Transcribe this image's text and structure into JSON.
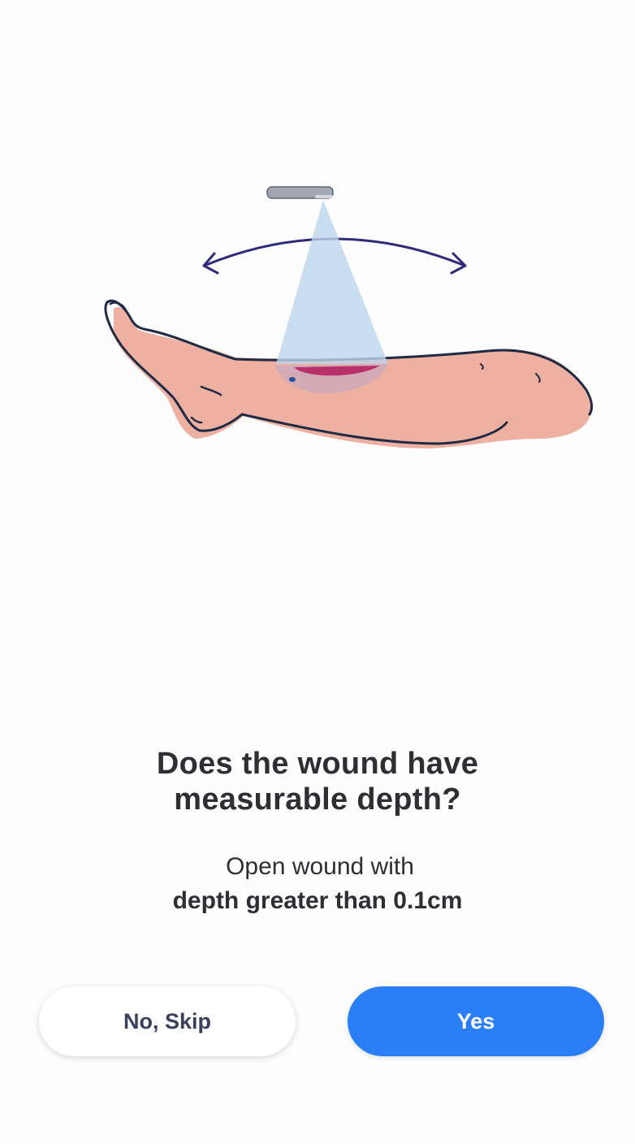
{
  "question": {
    "title_line1": "Does the wound have",
    "title_line2": "measurable depth?",
    "desc_line1": "Open wound with",
    "desc_line2": "depth greater than 0.1cm"
  },
  "actions": {
    "skip_label": "No, Skip",
    "yes_label": "Yes"
  },
  "illustration": {
    "icons": [
      "scanner-device-icon",
      "scan-beam-icon",
      "rotate-arrow-icon",
      "leg-icon",
      "wound-icon"
    ],
    "colors": {
      "skin": "#eeb0a0",
      "outline": "#1f2a44",
      "beam": "#bcd6ec",
      "wound": "#b8316b",
      "arrow": "#2f2a79",
      "device": "#9aa0aa"
    }
  },
  "theme": {
    "primary": "#2a7ff6",
    "background": "#fdfdfd"
  }
}
